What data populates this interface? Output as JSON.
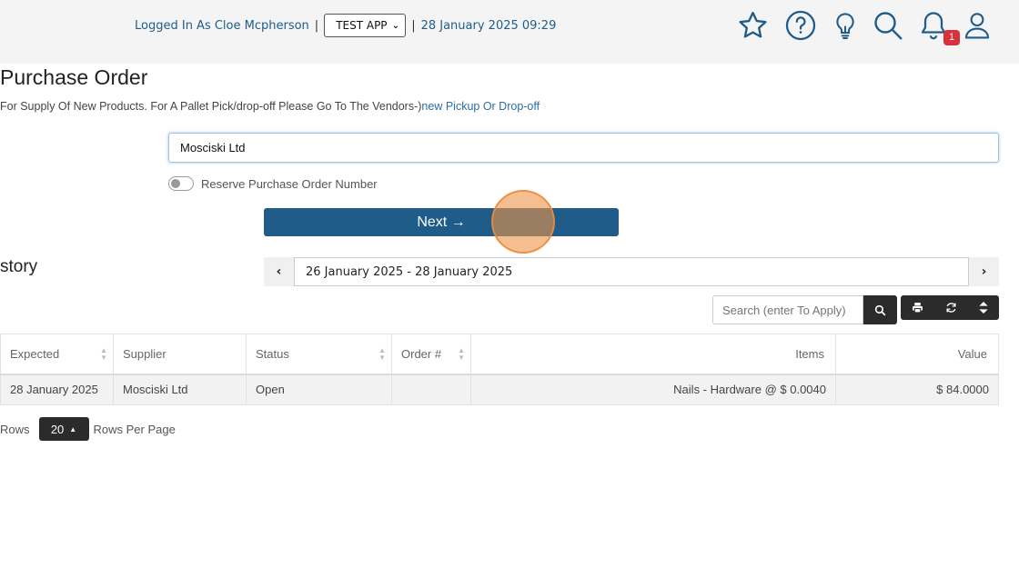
{
  "header": {
    "logged_in_text": "Logged In As Cloe Mcpherson",
    "separator": "|",
    "app_select_value": "TEST APP",
    "datetime": "28 January 2025 09:29",
    "notification_count": "1",
    "icons": [
      "star-icon",
      "help-icon",
      "lightbulb-icon",
      "search-icon",
      "bell-icon",
      "user-icon"
    ]
  },
  "page": {
    "title": "Purchase Order",
    "subtitle": "For Supply Of New Products. For A Pallet Pick/drop-off Please Go To The Vendors-)",
    "subtitle_link": "new Pickup Or Drop-off"
  },
  "form": {
    "supplier_value": "Mosciski Ltd",
    "reserve_label": "Reserve Purchase Order Number",
    "next_label": "Next →"
  },
  "history": {
    "title": "story",
    "date_range": "26 January 2025 - 28 January 2025",
    "search_placeholder": "Search (enter To Apply)",
    "columns": [
      "Expected",
      "Supplier",
      "Status",
      "Order #",
      "Items",
      "Value"
    ],
    "rows": [
      {
        "expected": "28 January 2025",
        "supplier": "Mosciski Ltd",
        "status": "Open",
        "order": "",
        "items": "Nails - Hardware @ $ 0.0040",
        "value": "$ 84.0000"
      }
    ]
  },
  "pager": {
    "rows_label": "Rows",
    "page_size": "20",
    "per_page_label": "Rows Per Page"
  },
  "colors": {
    "primary": "#1f5c8a",
    "dark": "#2b2b2b",
    "badge": "#d9313a"
  }
}
